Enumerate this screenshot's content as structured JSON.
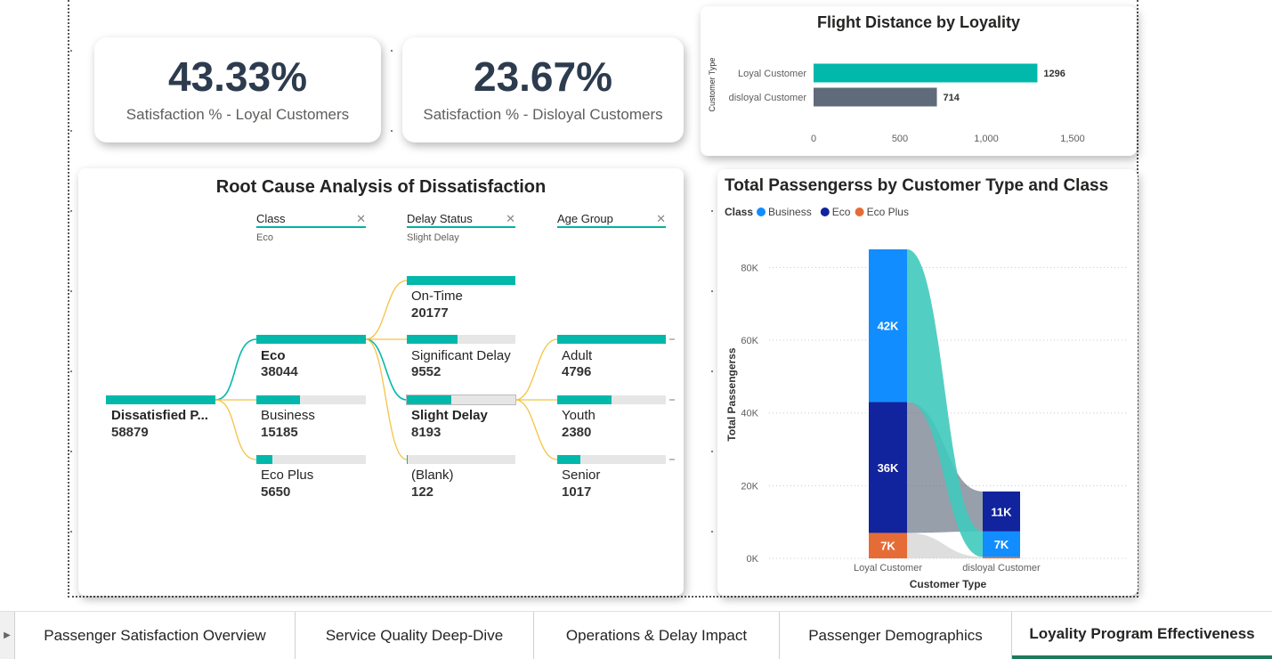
{
  "kpis": [
    {
      "value": "43.33%",
      "label": "Satisfaction % - Loyal Customers"
    },
    {
      "value": "23.67%",
      "label": "Satisfaction % - Disloyal Customers"
    }
  ],
  "flight_distance": {
    "title": "Flight Distance by Loyality",
    "y_axis_title": "Customer Type"
  },
  "root_cause": {
    "title": "Root Cause Analysis of Dissatisfaction",
    "levels": [
      {
        "name": "Class",
        "selected": "Eco",
        "close_icon": "close-icon"
      },
      {
        "name": "Delay Status",
        "selected": "Slight Delay",
        "close_icon": "close-icon"
      },
      {
        "name": "Age Group",
        "selected": "",
        "close_icon": "close-icon"
      }
    ],
    "root": {
      "label": "Dissatisfied P...",
      "value": "58879"
    },
    "class_nodes": [
      {
        "label": "Eco",
        "value": "38044"
      },
      {
        "label": "Business",
        "value": "15185"
      },
      {
        "label": "Eco Plus",
        "value": "5650"
      }
    ],
    "delay_nodes": [
      {
        "label": "On-Time",
        "value": "20177"
      },
      {
        "label": "Significant Delay",
        "value": "9552"
      },
      {
        "label": "Slight Delay",
        "value": "8193"
      },
      {
        "label": "(Blank)",
        "value": "122"
      }
    ],
    "age_nodes": [
      {
        "label": "Adult",
        "value": "4796"
      },
      {
        "label": "Youth",
        "value": "2380"
      },
      {
        "label": "Senior",
        "value": "1017"
      }
    ],
    "colors": {
      "bar": "#01b8aa",
      "track": "#e6e6e6",
      "link": "#f5c342",
      "selected_link": "#01b8aa"
    }
  },
  "passengers": {
    "title": "Total Passengerss by Customer Type and Class",
    "legend_title": "Class"
  },
  "chart_data": [
    {
      "type": "bar",
      "orientation": "horizontal",
      "title": "Flight Distance by Loyality",
      "ylabel": "Customer Type",
      "xlabel": "",
      "categories": [
        "Loyal Customer",
        "disloyal Customer"
      ],
      "values": [
        1296,
        714
      ],
      "value_labels": [
        "1296",
        "714"
      ],
      "colors": [
        "#01b8aa",
        "#5f6b7a"
      ],
      "xlim": [
        0,
        1500
      ],
      "xticks": [
        "0",
        "500",
        "1,000",
        "1,500"
      ],
      "grid": false
    },
    {
      "type": "bar",
      "stacked": true,
      "ribbon": true,
      "title": "Total Passengerss by Customer Type and Class",
      "xlabel": "Customer Type",
      "ylabel": "Total Passengerss",
      "categories": [
        "Loyal Customer",
        "disloyal Customer"
      ],
      "series": [
        {
          "name": "Eco Plus",
          "color": "#e66c37",
          "values": [
            7000,
            400
          ],
          "labels": [
            "7K",
            ""
          ]
        },
        {
          "name": "Eco",
          "color": "#12239e",
          "values": [
            36000,
            11000
          ],
          "labels": [
            "36K",
            "11K"
          ]
        },
        {
          "name": "Business",
          "color": "#118dff",
          "values": [
            42000,
            7000
          ],
          "labels": [
            "42K",
            "7K"
          ]
        }
      ],
      "stack_order": {
        "Loyal Customer": [
          "Eco Plus",
          "Eco",
          "Business"
        ],
        "disloyal Customer": [
          "Eco Plus",
          "Business",
          "Eco"
        ]
      },
      "ylim": [
        0,
        85000
      ],
      "yticks": [
        "0K",
        "20K",
        "40K",
        "60K",
        "80K"
      ],
      "legend": [
        "Business",
        "Eco",
        "Eco Plus"
      ],
      "legend_position": "top-left",
      "grid": true
    }
  ],
  "tabs": [
    {
      "label": "Passenger Satisfaction Overview",
      "active": false
    },
    {
      "label": "Service Quality Deep-Dive",
      "active": false
    },
    {
      "label": "Operations & Delay Impact",
      "active": false
    },
    {
      "label": "Passenger Demographics",
      "active": false
    },
    {
      "label": "Loyality Program Effectiveness",
      "active": true
    }
  ]
}
